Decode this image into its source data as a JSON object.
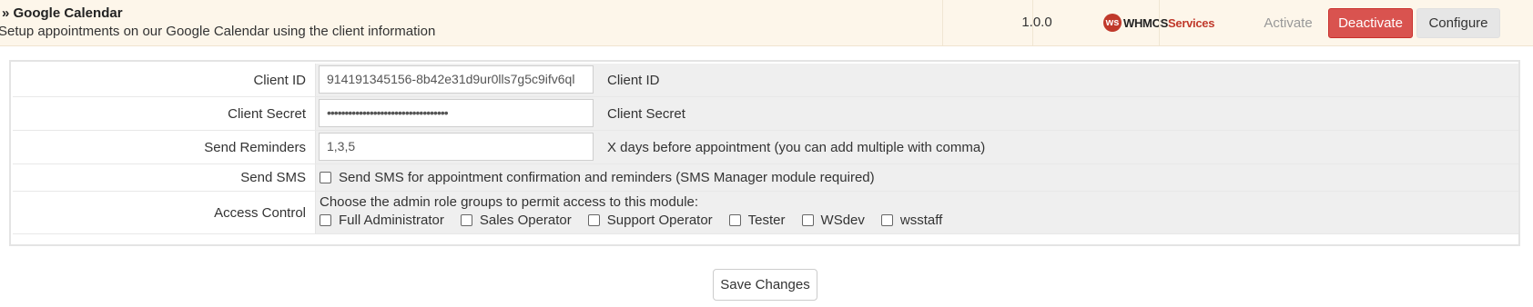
{
  "module": {
    "name": "» Google Calendar",
    "description": "Setup appointments on our Google Calendar using the client information",
    "version": "1.0.0",
    "vendor_logo": {
      "mark": "ws",
      "text_part1": "WHMCS",
      "text_part2": "Services"
    },
    "actions": {
      "activate": "Activate",
      "deactivate": "Deactivate",
      "configure": "Configure"
    }
  },
  "config": {
    "client_id": {
      "label": "Client ID",
      "value": "914191345156-8b42e31d9ur0lls7g5c9ifv6ql",
      "description": "Client ID"
    },
    "client_secret": {
      "label": "Client Secret",
      "value": "••••••••••••••••••••••••••••••••••",
      "description": "Client Secret"
    },
    "send_reminders": {
      "label": "Send Reminders",
      "value": "1,3,5",
      "description": "X days before appointment (you can add multiple with comma)"
    },
    "send_sms": {
      "label": "Send SMS",
      "checkbox_label": "Send SMS for appointment confirmation and reminders (SMS Manager module required)",
      "checked": false
    },
    "access_control": {
      "label": "Access Control",
      "instruction": "Choose the admin role groups to permit access to this module:",
      "roles": [
        {
          "label": "Full Administrator",
          "checked": false
        },
        {
          "label": "Sales Operator",
          "checked": false
        },
        {
          "label": "Support Operator",
          "checked": false
        },
        {
          "label": "Tester",
          "checked": false
        },
        {
          "label": "WSdev",
          "checked": false
        },
        {
          "label": "wsstaff",
          "checked": false
        }
      ]
    }
  },
  "save_button": "Save Changes",
  "colors": {
    "deactivate": "#d9534f",
    "header_bg": "#fdf6ea",
    "field_bg": "#efefef"
  }
}
